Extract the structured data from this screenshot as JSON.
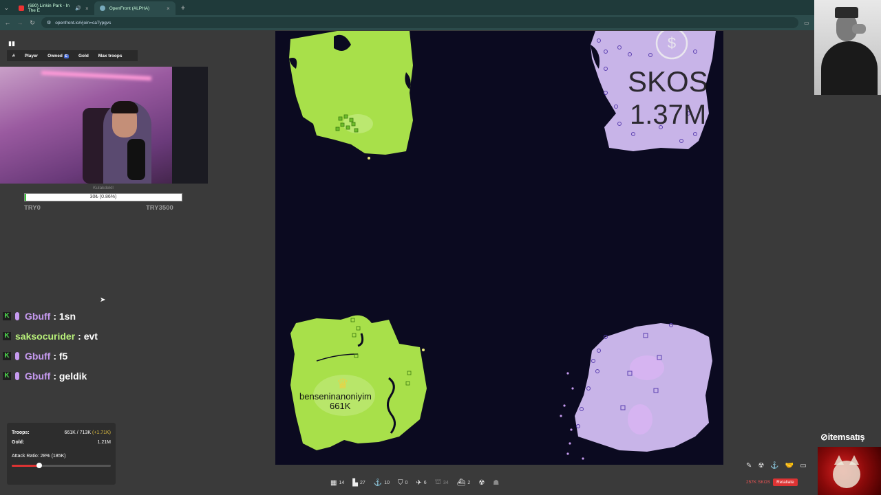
{
  "browser": {
    "tabs": [
      {
        "title": "(680) Linkin Park - In The E",
        "icon_color": "#e33",
        "icon": "youtube-icon"
      },
      {
        "title": "OpenFront (ALPHA)",
        "icon_color": "#7ab",
        "icon": "globe-icon"
      }
    ],
    "url": "openfront.io/#join=caTypgvs"
  },
  "leaderboard": {
    "columns": [
      "#",
      "Player",
      "Owned",
      "Gold",
      "Max troops"
    ],
    "owned_toggle": "E"
  },
  "donation": {
    "title": "Kulakdekll",
    "progress_text": "30₺ (0.86%)",
    "progress_percent": 0.86,
    "min_label": "TRY0",
    "max_label": "TRY3500"
  },
  "chat": [
    {
      "user": "Gbuff",
      "message": ": 1sn",
      "color": "#c69af0",
      "mic": true
    },
    {
      "user": "saksocurider",
      "message": ": evt",
      "color": "#b8f07a",
      "mic": false
    },
    {
      "user": "Gbuff",
      "message": ": f5",
      "color": "#c69af0",
      "mic": true
    },
    {
      "user": "Gbuff",
      "message": ": geldik",
      "color": "#c69af0",
      "mic": true
    }
  ],
  "stats": {
    "troops_label": "Troops:",
    "troops_value": "661K / 713K",
    "troops_delta": "(+1.71K)",
    "gold_label": "Gold:",
    "gold_value": "1.21M",
    "attack_ratio_label": "Attack Ratio: 28% (185K)",
    "attack_ratio": 28
  },
  "map": {
    "players": [
      {
        "name": "SKOS",
        "troops": "1.37M",
        "color": "#c8b4e8"
      },
      {
        "name": "benseninanoniyim",
        "troops": "661K",
        "color": "#a8e04a"
      }
    ],
    "colors": {
      "ocean": "#0b0a20",
      "player_land": "#a8e04a",
      "enemy_land": "#c8b4e8",
      "enemy_structure": "#5a3fb0"
    }
  },
  "bottom_bar": [
    {
      "icon": "city-icon",
      "glyph": "▦",
      "count": "14",
      "enabled": true
    },
    {
      "icon": "factory-icon",
      "glyph": "▙",
      "count": "27",
      "enabled": true
    },
    {
      "icon": "port-icon",
      "glyph": "⚓",
      "count": "10",
      "enabled": true
    },
    {
      "icon": "defense-icon",
      "glyph": "⛉",
      "count": "0",
      "enabled": true
    },
    {
      "icon": "missile-silo-icon",
      "glyph": "✈",
      "count": "6",
      "enabled": true
    },
    {
      "icon": "sam-launcher-icon",
      "glyph": "⛫",
      "count": "34",
      "enabled": false
    },
    {
      "icon": "warship-icon",
      "glyph": "⛴",
      "count": "2",
      "enabled": true
    },
    {
      "icon": "nuke-icon",
      "glyph": "☢",
      "count": "",
      "enabled": true
    },
    {
      "icon": "hydrogen-bomb-icon",
      "glyph": "☗",
      "count": "",
      "enabled": false
    }
  ],
  "actions": {
    "incoming_attack": "257K SKOS",
    "retaliate_label": "Retaliate"
  },
  "overlay": {
    "brand": "itemsatış"
  }
}
